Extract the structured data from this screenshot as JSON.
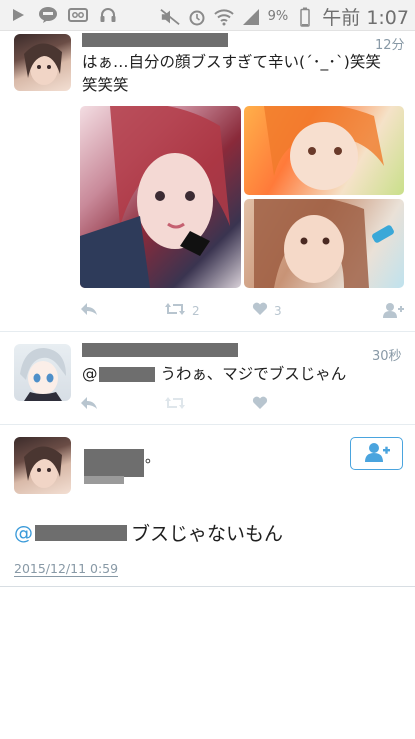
{
  "status_bar": {
    "icons_left": [
      "play-icon",
      "line-icon",
      "voicemail-icon",
      "headphones-icon"
    ],
    "icons_right": [
      "mute-icon",
      "alarm-icon",
      "wifi-icon",
      "signal-icon",
      "battery-icon"
    ],
    "battery_percent": "9%",
    "time": "午前 1:07"
  },
  "tweet1": {
    "time": "12分",
    "text_line1": "はぁ…自分の顔ブスすぎて辛い(´･_･`)笑笑",
    "text_line2": "笑笑笑",
    "retweet_count": "2",
    "like_count": "3"
  },
  "tweet2": {
    "time": "30秒",
    "mention": "@",
    "text": "うわぁ、マジでブスじゃん"
  },
  "tweet3": {
    "name_suffix": "。",
    "mention": "@",
    "text": "ブスじゃないもん",
    "date": "2015/12/11 0:59"
  },
  "colors": {
    "accent": "#4aa4de",
    "meta_gray": "#8899a6",
    "icon_gray": "#b8c5cf"
  }
}
